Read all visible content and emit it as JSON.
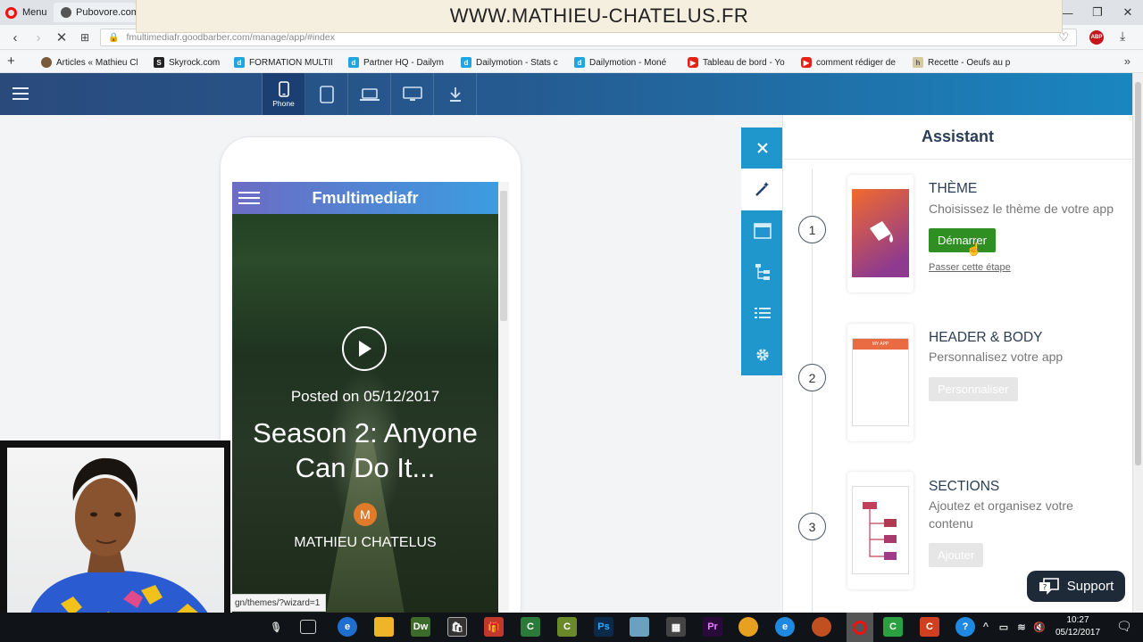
{
  "browser": {
    "menu_label": "Menu",
    "tab_title": "Pubovore.com -",
    "watermark": "WWW.MATHIEU-CHATELUS.FR",
    "url_host": "fmultimediafr.goodbarber.com",
    "url_path": "/manage/app/#index",
    "abp_badge": "ABP",
    "bookmarks": [
      {
        "label": "Articles « Mathieu Ch",
        "icon": "wordpress-icon"
      },
      {
        "label": "Skyrock.com",
        "icon": "skyrock-icon"
      },
      {
        "label": "FORMATION MULTIM",
        "icon": "dailymotion-icon"
      },
      {
        "label": "Partner HQ - Dailym",
        "icon": "dailymotion-icon"
      },
      {
        "label": "Dailymotion - Stats c",
        "icon": "dailymotion-icon"
      },
      {
        "label": "Dailymotion - Moné",
        "icon": "dailymotion-icon"
      },
      {
        "label": "Tableau de bord - Yo",
        "icon": "youtube-icon"
      },
      {
        "label": "comment rédiger de",
        "icon": "youtube-icon"
      },
      {
        "label": "Recette - Oeufs au p",
        "icon": "recipe-icon"
      }
    ],
    "status_url": "gn/themes/?wizard=1"
  },
  "app": {
    "devices": [
      {
        "label": "Phone",
        "icon": "phone-icon",
        "active": true
      },
      {
        "label": "",
        "icon": "tablet-icon",
        "active": false
      },
      {
        "label": "",
        "icon": "laptop-icon",
        "active": false
      },
      {
        "label": "",
        "icon": "desktop-icon",
        "active": false
      },
      {
        "label": "",
        "icon": "download-icon",
        "active": false
      }
    ]
  },
  "preview": {
    "app_name": "Fmultimediafr",
    "posted": "Posted on 05/12/2017",
    "title": "Season 2: Anyone Can Do It...",
    "author_initial": "M",
    "author": "MATHIEU CHATELUS"
  },
  "assistant": {
    "title": "Assistant",
    "steps": [
      {
        "number": "1",
        "title": "THÈME",
        "desc": "Choisissez le thème de votre app",
        "button": "Démarrer",
        "skip": "Passer cette étape"
      },
      {
        "number": "2",
        "title": "HEADER & BODY",
        "desc": "Personnalisez votre app",
        "button": "Personnaliser",
        "thumb_label": "MY APP"
      },
      {
        "number": "3",
        "title": "SECTIONS",
        "desc": "Ajoutez et organisez votre contenu",
        "button": "Ajouter"
      }
    ],
    "support": "Support"
  },
  "taskbar": {
    "time": "10:27",
    "date": "05/12/2017"
  },
  "colors": {
    "header_start": "#2a4a7c",
    "header_end": "#1a86c0",
    "tool_blue": "#1f97cc",
    "start_button": "#2f8f23",
    "support_bg": "#1e2a38"
  }
}
